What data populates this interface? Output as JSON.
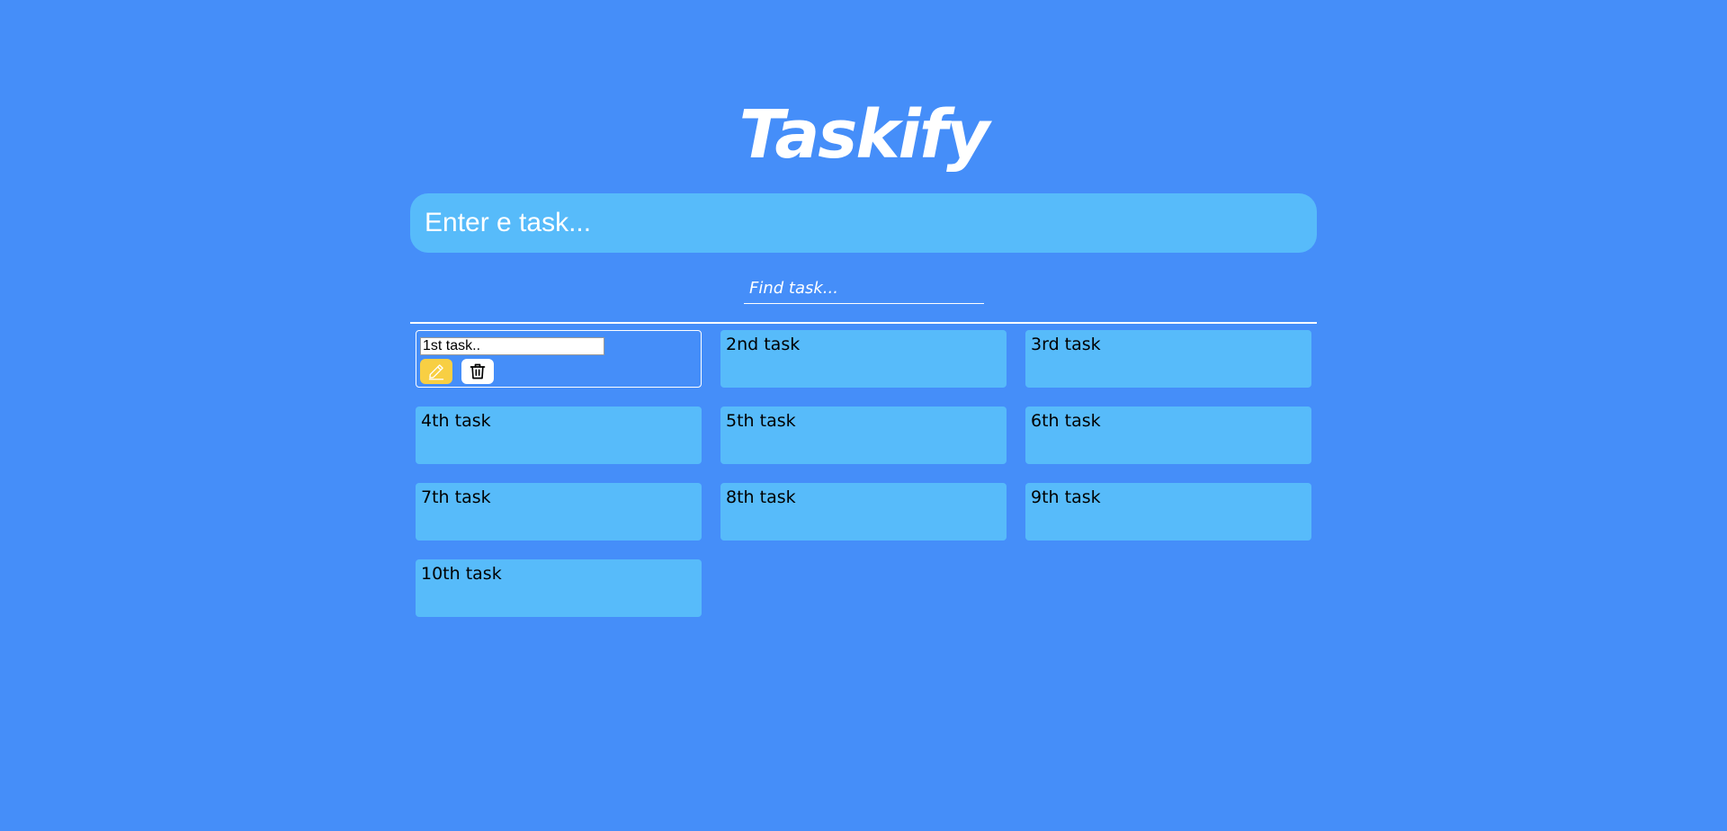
{
  "app": {
    "title": "Taskify"
  },
  "task_input": {
    "placeholder": "Enter e task...",
    "value": ""
  },
  "find_input": {
    "placeholder": "Find task...",
    "value": ""
  },
  "editing_task": {
    "value": "1st task.."
  },
  "actions": {
    "edit_icon": "pencil-icon",
    "delete_icon": "trash-icon"
  },
  "tasks": [
    {
      "label": "1st task.."
    },
    {
      "label": "2nd task"
    },
    {
      "label": "3rd task"
    },
    {
      "label": "4th task"
    },
    {
      "label": "5th task"
    },
    {
      "label": "6th task"
    },
    {
      "label": "7th task"
    },
    {
      "label": "8th task"
    },
    {
      "label": "9th task"
    },
    {
      "label": "10th task"
    }
  ],
  "colors": {
    "background": "#458ef9",
    "card": "#57bbfa",
    "edit_button": "#f8cf43",
    "delete_button": "#ffffff",
    "text_light": "#ffffff"
  }
}
